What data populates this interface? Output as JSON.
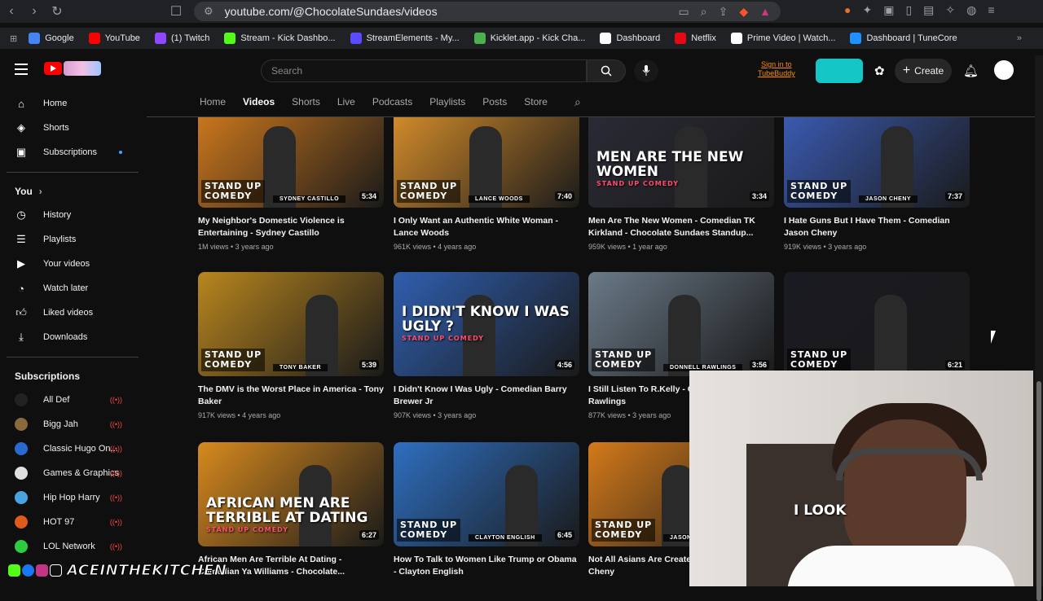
{
  "browser": {
    "url": "youtube.com/@ChocolateSundaes/videos",
    "bookmarks": [
      {
        "label": "Google",
        "color": "#4285f4"
      },
      {
        "label": "YouTube",
        "color": "#ff0000"
      },
      {
        "label": "(1) Twitch",
        "color": "#9146ff"
      },
      {
        "label": "Stream - Kick Dashbo...",
        "color": "#53fc18"
      },
      {
        "label": "StreamElements - My...",
        "color": "#5a4bff"
      },
      {
        "label": "Kicklet.app - Kick Cha...",
        "color": "#4caf50"
      },
      {
        "label": "Dashboard",
        "color": "#ffffff"
      },
      {
        "label": "Netflix",
        "color": "#e50914"
      },
      {
        "label": "Prime Video | Watch...",
        "color": "#ffffff"
      },
      {
        "label": "Dashboard | TuneCore",
        "color": "#1e90ff"
      }
    ]
  },
  "header": {
    "search_placeholder": "Search",
    "tubebuddy_line1": "Sign in to",
    "tubebuddy_line2": "TubeBuddy",
    "create_label": "Create"
  },
  "sidebar": {
    "main": [
      {
        "label": "Home",
        "icon": "home-icon"
      },
      {
        "label": "Shorts",
        "icon": "shorts-icon"
      },
      {
        "label": "Subscriptions",
        "icon": "subscriptions-icon"
      }
    ],
    "you_heading": "You",
    "you_items": [
      {
        "label": "History",
        "icon": "history-icon"
      },
      {
        "label": "Playlists",
        "icon": "playlists-icon"
      },
      {
        "label": "Your videos",
        "icon": "your-videos-icon"
      },
      {
        "label": "Watch later",
        "icon": "watch-later-icon"
      },
      {
        "label": "Liked videos",
        "icon": "liked-icon"
      },
      {
        "label": "Downloads",
        "icon": "downloads-icon"
      }
    ],
    "subs_heading": "Subscriptions",
    "subs": [
      {
        "label": "All Def",
        "color": "#222222"
      },
      {
        "label": "Bigg Jah",
        "color": "#8a6a3a"
      },
      {
        "label": "Classic Hugo On...",
        "color": "#2a6ad0"
      },
      {
        "label": "Games & Graphics",
        "color": "#e0e0e0"
      },
      {
        "label": "Hip Hop Harry",
        "color": "#4aa3df"
      },
      {
        "label": "HOT 97",
        "color": "#e05a1a"
      },
      {
        "label": "LOL Network",
        "color": "#2ecc40"
      }
    ]
  },
  "tabs": [
    "Home",
    "Videos",
    "Shorts",
    "Live",
    "Podcasts",
    "Playlists",
    "Posts",
    "Store"
  ],
  "videos": [
    {
      "title": "My Neighbor's Domestic Violence is Entertaining - Sydney Castillo",
      "meta": "1M views • 3 years ago",
      "duration": "5:34",
      "badge1": "STAND UP",
      "badge2": "COMEDY",
      "tag": "SYDNEY CASTILLO",
      "overlay": "",
      "overlay_small": "",
      "bg": "#c9761d"
    },
    {
      "title": "I Only Want an Authentic White Woman - Lance Woods",
      "meta": "961K views • 4 years ago",
      "duration": "7:40",
      "badge1": "STAND UP",
      "badge2": "COMEDY",
      "tag": "LANCE WOODS",
      "overlay": "",
      "overlay_small": "",
      "bg": "#d08a2a"
    },
    {
      "title": "Men Are The New Women - Comedian TK Kirkland - Chocolate Sundaes Standup...",
      "meta": "959K views • 1 year ago",
      "duration": "3:34",
      "badge1": "",
      "badge2": "",
      "tag": "",
      "overlay": "MEN ARE THE NEW WOMEN",
      "overlay_small": "STAND UP COMEDY",
      "bg": "#2a2a35"
    },
    {
      "title": "I Hate Guns But I Have Them - Comedian Jason Cheny",
      "meta": "919K views • 3 years ago",
      "duration": "7:37",
      "badge1": "STAND UP",
      "badge2": "COMEDY",
      "tag": "JASON CHENY",
      "overlay": "",
      "overlay_small": "",
      "bg": "#3a5ab0"
    },
    {
      "title": "The DMV is the Worst Place in America - Tony Baker",
      "meta": "917K views • 4 years ago",
      "duration": "5:39",
      "badge1": "STAND UP",
      "badge2": "COMEDY",
      "tag": "TONY BAKER",
      "overlay": "",
      "overlay_small": "",
      "bg": "#b8861e"
    },
    {
      "title": "I Didn't Know I Was Ugly - Comedian Barry Brewer Jr",
      "meta": "907K views • 3 years ago",
      "duration": "4:56",
      "badge1": "",
      "badge2": "",
      "tag": "",
      "overlay": "I DIDN'T KNOW I WAS UGLY ?",
      "overlay_small": "STAND UP COMEDY",
      "bg": "#2f5fb0"
    },
    {
      "title": "I Still Listen To R.Kelly - Comedian Donnell Rawlings",
      "meta": "877K views • 3 years ago",
      "duration": "3:56",
      "badge1": "STAND UP",
      "badge2": "COMEDY",
      "tag": "DONNELL RAWLINGS",
      "overlay": "",
      "overlay_small": "",
      "bg": "#6a7a88"
    },
    {
      "title": "",
      "meta": "",
      "duration": "6:21",
      "badge1": "STAND UP",
      "badge2": "COMEDY",
      "tag": "",
      "overlay": "",
      "overlay_small": "",
      "bg": "#1a1a22"
    },
    {
      "title": "African Men Are Terrible At Dating - Comedian Ya Williams - Chocolate...",
      "meta": "",
      "duration": "6:27",
      "badge1": "",
      "badge2": "",
      "tag": "",
      "overlay": "AFRICAN MEN ARE TERRIBLE AT DATING",
      "overlay_small": "STAND UP COMEDY",
      "bg": "#d88a1e"
    },
    {
      "title": "How To Talk to Women Like Trump or Obama - Clayton English",
      "meta": "",
      "duration": "6:45",
      "badge1": "STAND UP",
      "badge2": "COMEDY",
      "tag": "CLAYTON ENGLISH",
      "overlay": "",
      "overlay_small": "",
      "bg": "#2e6fc0"
    },
    {
      "title": "Not All Asians Are Created Equal - Jason Cheny",
      "meta": "",
      "duration": "",
      "badge1": "STAND UP",
      "badge2": "COMEDY",
      "tag": "JASON",
      "overlay": "",
      "overlay_small": "",
      "bg": "#d47a1a"
    }
  ],
  "webcam": {
    "overlay_text": "I LOOK"
  },
  "streamer": {
    "name": "ACEINTHEKITCHEN"
  }
}
